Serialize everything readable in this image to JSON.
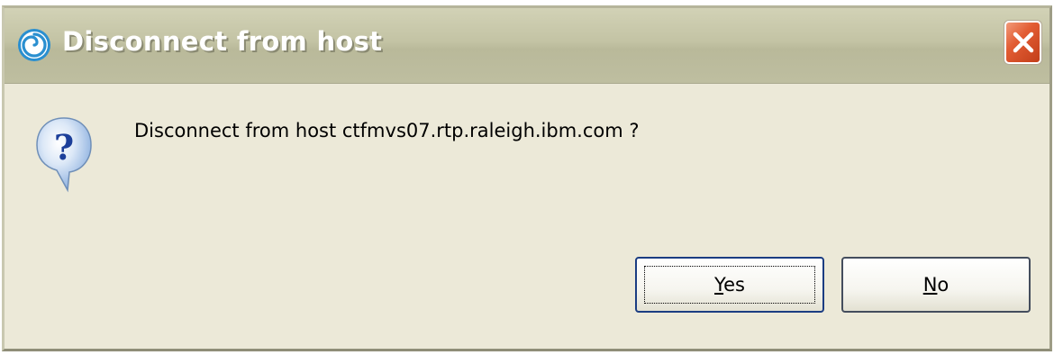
{
  "window": {
    "title": "Disconnect from host",
    "close_glyph": "✕"
  },
  "message": {
    "text": "Disconnect from host ctfmvs07.rtp.raleigh.ibm.com ?",
    "icon": "question-icon"
  },
  "buttons": {
    "yes": {
      "mnemonic": "Y",
      "rest": "es",
      "default": true
    },
    "no": {
      "mnemonic": "N",
      "rest": "o",
      "default": false
    }
  },
  "colors": {
    "dialog_background": "#ece9d8",
    "titlebar": "#c3c3a4",
    "close_button": "#e25c33",
    "question_bubble": "#5c8fd6"
  }
}
